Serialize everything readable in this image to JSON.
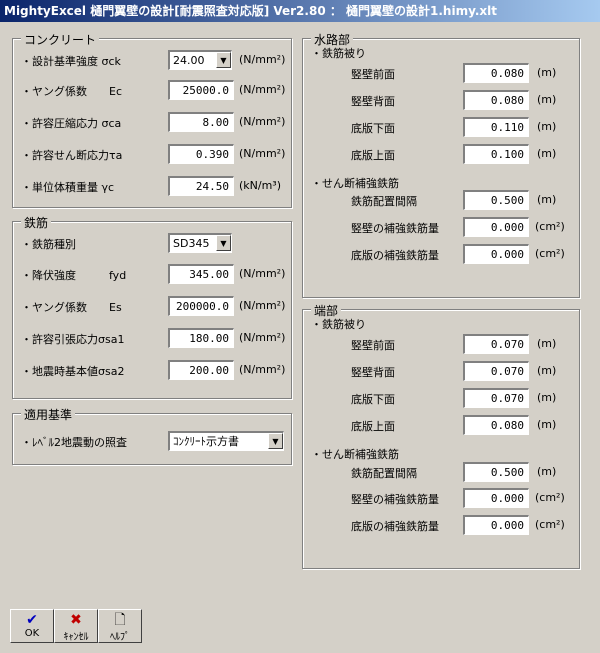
{
  "window": {
    "title": "MightyExcel 樋門翼壁の設計[耐震照査対応版] Ver2.80 ： 樋門翼壁の設計1.himy.xlt"
  },
  "concrete": {
    "title": "コンクリート",
    "fields": [
      {
        "label": "・設計基準強度 σck",
        "value": "24.00",
        "unit": "(N/mm²)",
        "type": "combo"
      },
      {
        "label": "・ヤング係数　　Ec",
        "value": "25000.0",
        "unit": "(N/mm²)"
      },
      {
        "label": "・許容圧縮応力 σca",
        "value": "8.00",
        "unit": "(N/mm²)"
      },
      {
        "label": "・許容せん断応力τa",
        "value": "0.390",
        "unit": "(N/mm²)"
      },
      {
        "label": "・単位体積重量 γc",
        "value": "24.50",
        "unit": "(kN/m³)"
      }
    ]
  },
  "rebar": {
    "title": "鉄筋",
    "fields": [
      {
        "label": "・鉄筋種別",
        "value": "SD345",
        "unit": "",
        "type": "combo"
      },
      {
        "label": "・降伏強度　　　fyd",
        "value": "345.00",
        "unit": "(N/mm²)"
      },
      {
        "label": "・ヤング係数　　Es",
        "value": "200000.0",
        "unit": "(N/mm²)"
      },
      {
        "label": "・許容引張応力σsa1",
        "value": "180.00",
        "unit": "(N/mm²)"
      },
      {
        "label": "・地震時基本値σsa2",
        "value": "200.00",
        "unit": "(N/mm²)"
      }
    ]
  },
  "standard": {
    "title": "適用基準",
    "label": "・ﾚﾍﾞﾙ2地震動の照査",
    "value": "ｺﾝｸﾘｰﾄ示方書"
  },
  "waterway": {
    "title": "水路部",
    "cover_title": "・鉄筋被り",
    "cover": [
      {
        "label": "竪壁前面",
        "value": "0.080",
        "unit": "(m)"
      },
      {
        "label": "竪壁背面",
        "value": "0.080",
        "unit": "(m)"
      },
      {
        "label": "底版下面",
        "value": "0.110",
        "unit": "(m)"
      },
      {
        "label": "底版上面",
        "value": "0.100",
        "unit": "(m)"
      }
    ],
    "shear_title": "・せん断補強鉄筋",
    "shear": [
      {
        "label": "鉄筋配置間隔",
        "value": "0.500",
        "unit": "(m)"
      },
      {
        "label": "竪壁の補強鉄筋量",
        "value": "0.000",
        "unit": "(cm²)"
      },
      {
        "label": "底版の補強鉄筋量",
        "value": "0.000",
        "unit": "(cm²)"
      }
    ]
  },
  "end": {
    "title": "端部",
    "cover_title": "・鉄筋被り",
    "cover": [
      {
        "label": "竪壁前面",
        "value": "0.070",
        "unit": "(m)"
      },
      {
        "label": "竪壁背面",
        "value": "0.070",
        "unit": "(m)"
      },
      {
        "label": "底版下面",
        "value": "0.070",
        "unit": "(m)"
      },
      {
        "label": "底版上面",
        "value": "0.080",
        "unit": "(m)"
      }
    ],
    "shear_title": "・せん断補強鉄筋",
    "shear": [
      {
        "label": "鉄筋配置間隔",
        "value": "0.500",
        "unit": "(m)"
      },
      {
        "label": "竪壁の補強鉄筋量",
        "value": "0.000",
        "unit": "(cm²)"
      },
      {
        "label": "底版の補強鉄筋量",
        "value": "0.000",
        "unit": "(cm²)"
      }
    ]
  },
  "toolbar": {
    "ok_label": "OK",
    "cancel_label": "ｷｬﾝｾﾙ",
    "help_label": "ﾍﾙﾌﾟ",
    "ok_icon": "check-icon",
    "cancel_icon": "x-icon",
    "help_icon": "document-icon",
    "ok_color": "#0000c0",
    "cancel_color": "#c00000"
  }
}
